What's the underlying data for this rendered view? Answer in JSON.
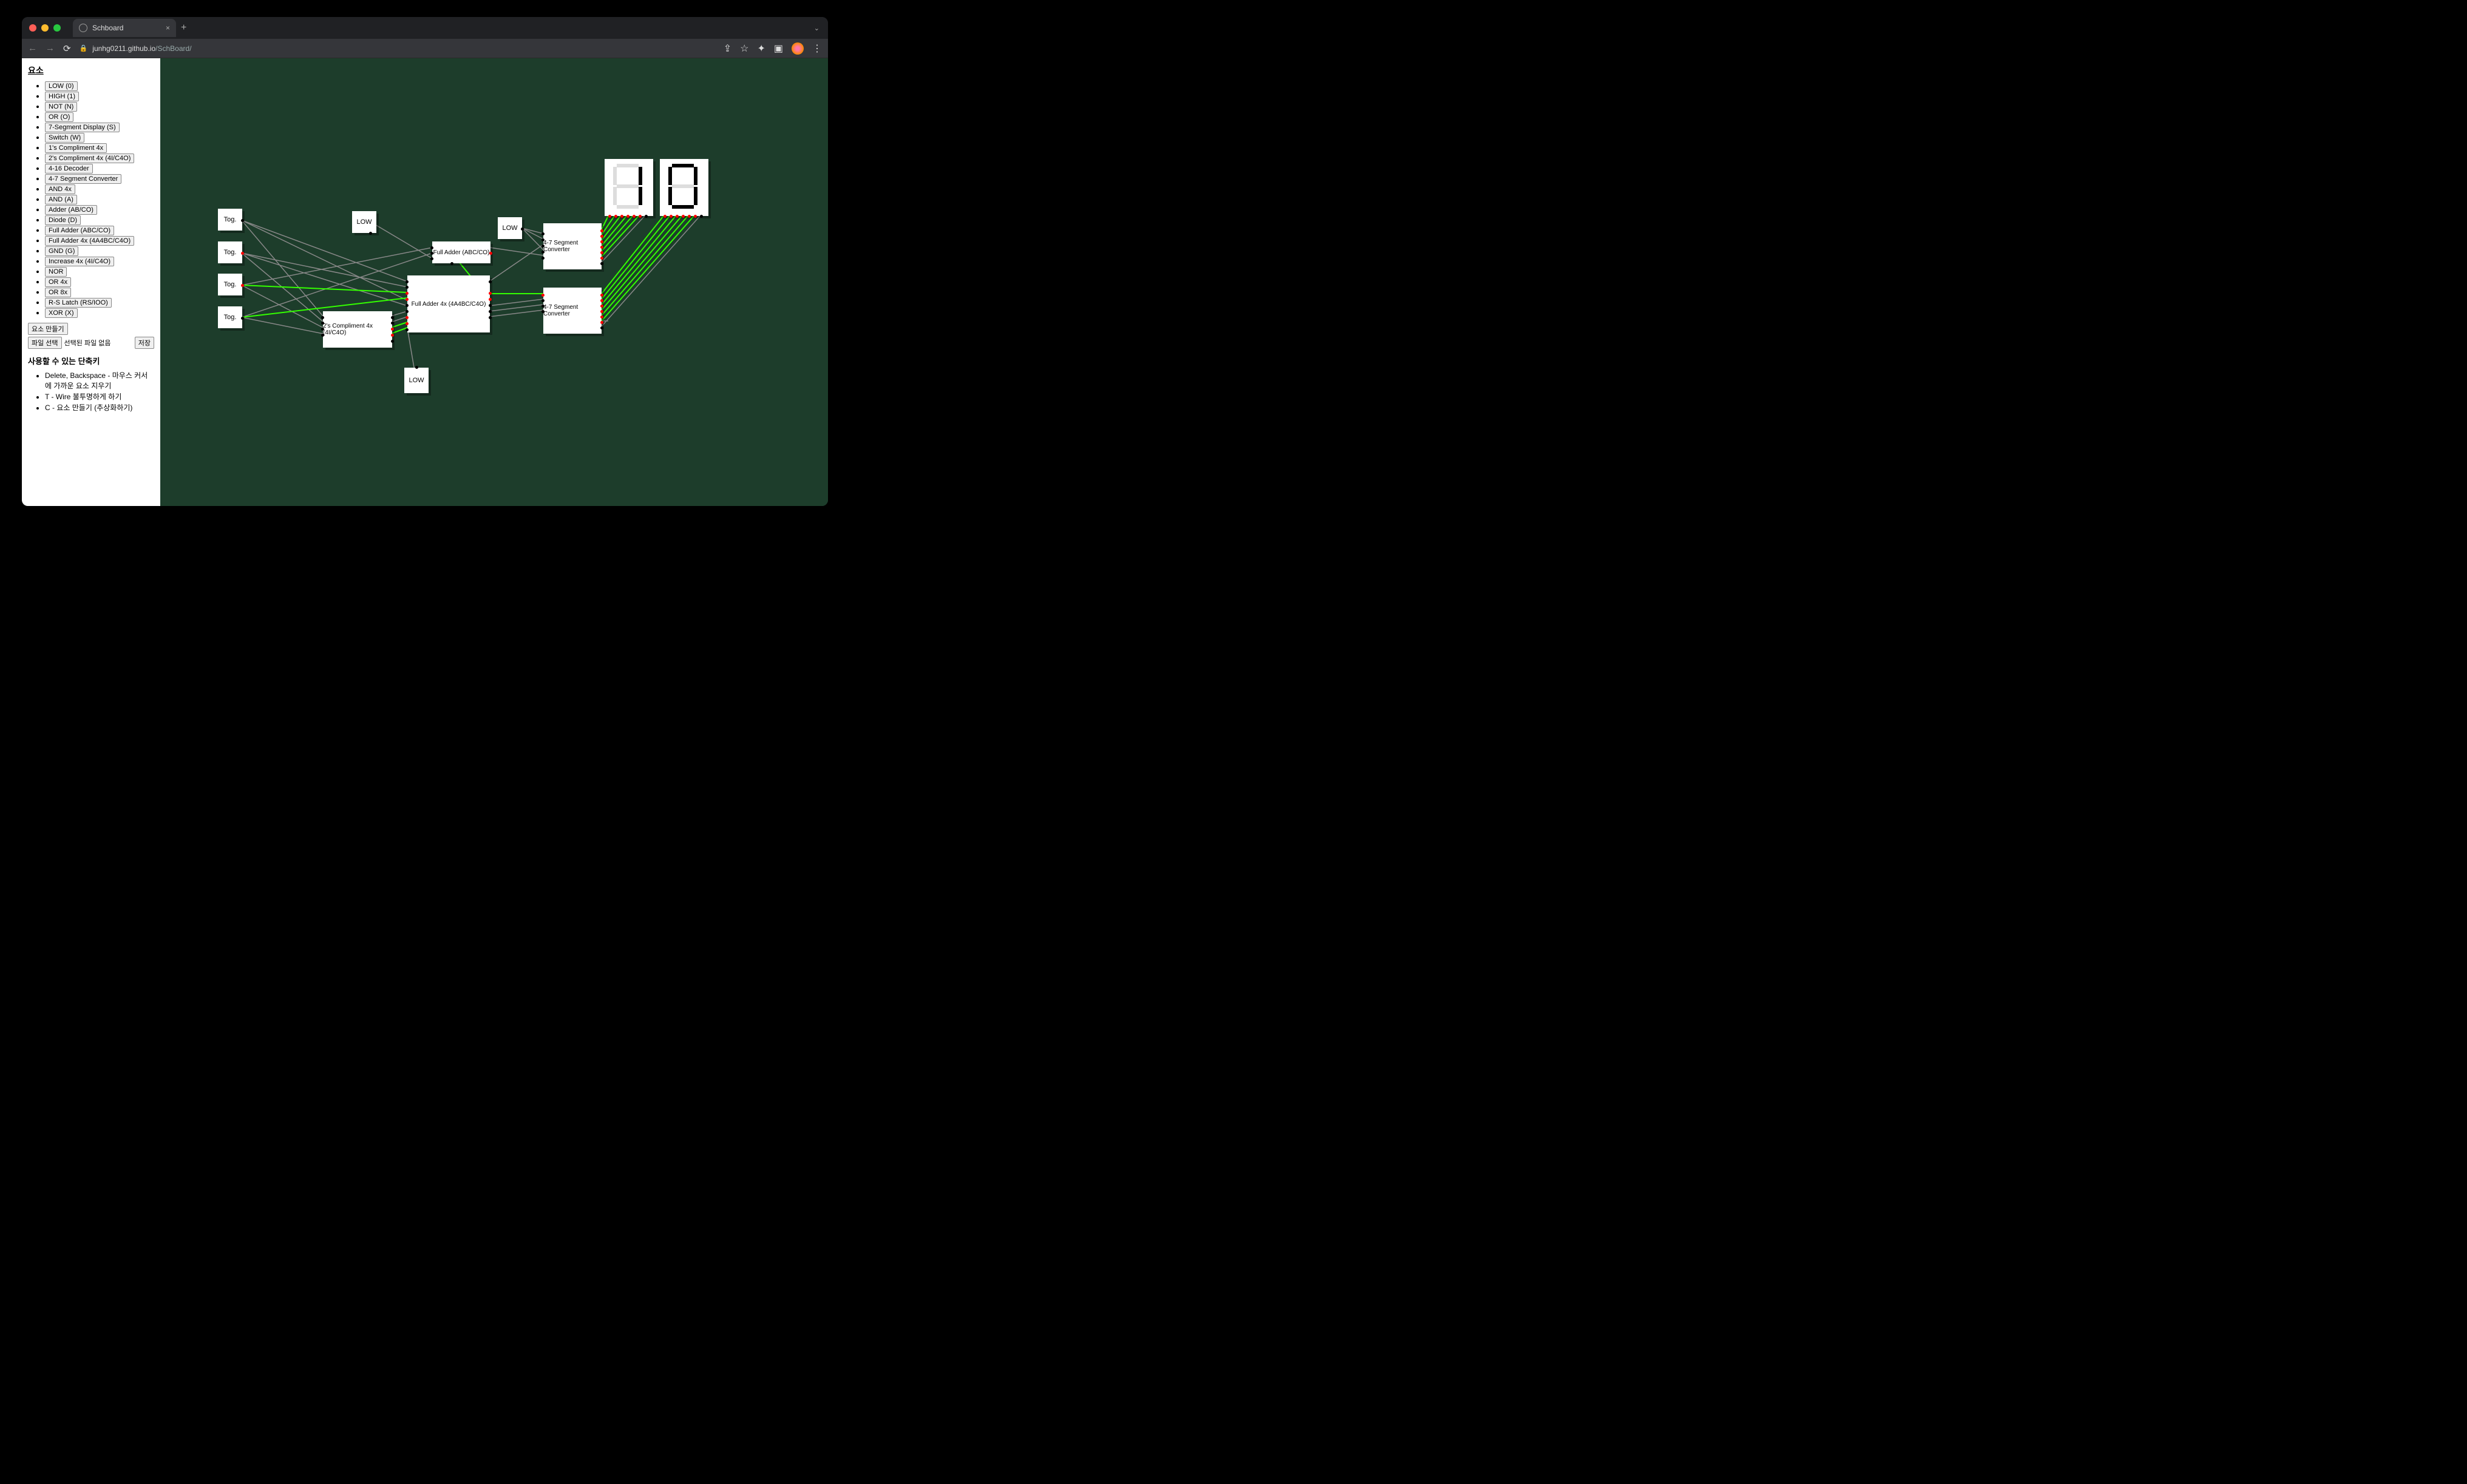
{
  "browser": {
    "tab_title": "Schboard",
    "url_host": "junhg0211.github.io",
    "url_path": "/SchBoard/"
  },
  "sidebar": {
    "heading": "요소",
    "elements": [
      "LOW (0)",
      "HIGH (1)",
      "NOT (N)",
      "OR (O)",
      "7-Segment Display (S)",
      "Switch (W)",
      "1's Compliment 4x",
      "2's Compliment 4x (4I/C4O)",
      "4-16 Decoder",
      "4-7 Segment Converter",
      "AND 4x",
      "AND (A)",
      "Adder (AB/CO)",
      "Diode (D)",
      "Full Adder (ABC/CO)",
      "Full Adder 4x (4A4BC/C4O)",
      "GND (G)",
      "Increase 4x (4I/C4O)",
      "NOR",
      "OR 4x",
      "OR 8x",
      "R-S Latch (RS/IOO)",
      "XOR (X)"
    ],
    "create_element": "요소 만들기",
    "file_select": "파일 선택",
    "no_file": "선택된 파일 없음",
    "save": "저장",
    "shortcuts_heading": "사용할 수 있는 단축키",
    "shortcuts": [
      "Delete, Backspace - 마우스 커서에 가까운 요소 지우기",
      "T - Wire 불투명하게 하기",
      "C - 요소 만들기 (추상화하기)"
    ]
  },
  "nodes": {
    "tog1": "Tog.",
    "tog2": "Tog.",
    "tog3": "Tog.",
    "tog4": "Tog.",
    "low1": "LOW",
    "low2": "LOW",
    "low3": "LOW",
    "comp2s": "2's Compliment 4x (4I/C4O)",
    "fa1": "Full Adder (ABC/CO)",
    "fa4x": "Full Adder 4x (4A4BC/C4O)",
    "conv1": "4-7 Segment Converter",
    "conv2": "4-7 Segment Converter"
  }
}
